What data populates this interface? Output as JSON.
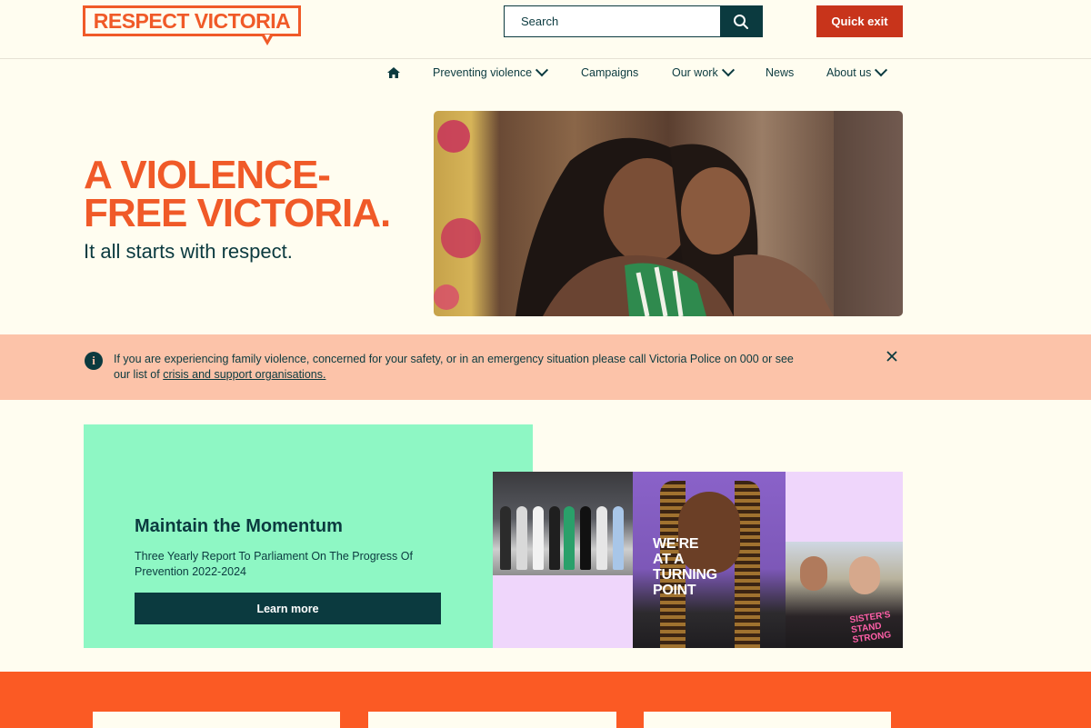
{
  "header": {
    "logo_text": "RESPECT VICTORIA",
    "search_placeholder": "Search",
    "quick_exit_label": "Quick exit"
  },
  "nav": {
    "items": [
      {
        "label": "Preventing violence",
        "has_dropdown": true
      },
      {
        "label": "Campaigns",
        "has_dropdown": false
      },
      {
        "label": "Our work",
        "has_dropdown": true
      },
      {
        "label": "News",
        "has_dropdown": false
      },
      {
        "label": "About us",
        "has_dropdown": true
      }
    ]
  },
  "hero": {
    "title_line1": "A VIOLENCE-",
    "title_line2": "FREE VICTORIA.",
    "subtitle": "It all starts with respect."
  },
  "alert": {
    "text": "If you are experiencing family violence, concerned for your safety, or in an emergency situation please call Victoria Police on 000 or see our list of ",
    "link_text": "crisis and support organisations."
  },
  "feature": {
    "title": "Maintain the Momentum",
    "description": "Three Yearly Report To Parliament On The Progress Of Prevention 2022-2024",
    "button_label": "Learn more",
    "collage_text": "WE'RE\nAT A\nTURNING\nPOINT",
    "shirt_text": "SISTER'S\nSTAND\nSTRONG"
  },
  "colors": {
    "brand_orange": "#f05a28",
    "dark_teal": "#0b3a3f",
    "quick_exit_red": "#c8341b",
    "alert_bg": "#fcc3a9",
    "feature_green": "#8ef7c4",
    "page_bg": "#fffdf0"
  },
  "icons": {
    "home": "home-icon",
    "search": "search-icon",
    "info": "info-icon",
    "close": "close-icon"
  }
}
